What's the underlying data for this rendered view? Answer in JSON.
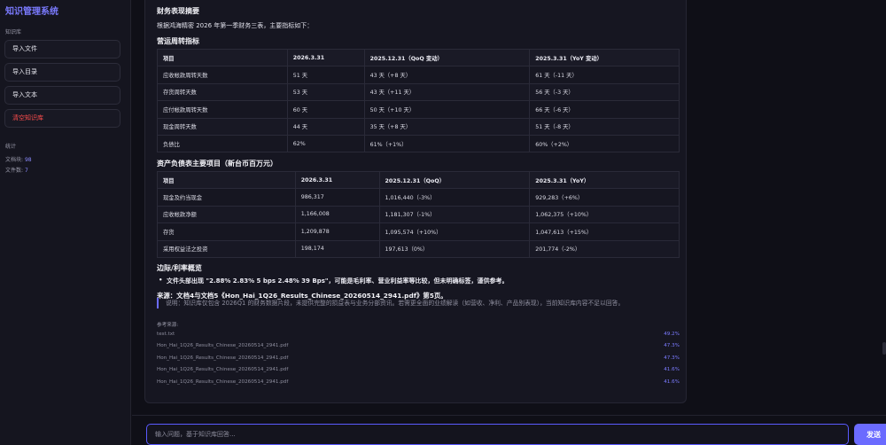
{
  "sidebar": {
    "title": "知识管理系统",
    "kb_label": "知识库",
    "buttons": {
      "import_file": "导入文件",
      "import_dir": "导入目录",
      "import_text": "导入文本",
      "clear_kb": "清空知识库"
    },
    "stats_label": "统计",
    "stats": {
      "chunks_label": "文档块: ",
      "chunks_value": "98",
      "files_label": "文件数: ",
      "files_value": "7"
    }
  },
  "answer": {
    "title": "财务表现摘要",
    "intro": "根据鸿海精密 2026 年第一季财务三表，主要指标如下：",
    "turnover": {
      "heading": "营运周转指标",
      "headers": [
        "项目",
        "2026.3.31",
        "2025.12.31（QoQ 变动）",
        "2025.3.31（YoY 变动）"
      ],
      "rows": [
        [
          "应收帐款周转天数",
          "51 天",
          "43 天（+8 天）",
          "61 天（-11 天）"
        ],
        [
          "存货周转天数",
          "53 天",
          "43 天（+11 天）",
          "56 天（-3 天）"
        ],
        [
          "应付帐款周转天数",
          "60 天",
          "50 天（+10 天）",
          "66 天（-6 天）"
        ],
        [
          "现金周转天数",
          "44 天",
          "35 天（+8 天）",
          "51 天（-8 天）"
        ],
        [
          "负债比",
          "62%",
          "61%（+1%）",
          "60%（+2%）"
        ]
      ]
    },
    "balance": {
      "heading": "资产负债表主要项目（新台币百万元）",
      "headers": [
        "项目",
        "2026.3.31",
        "2025.12.31（QoQ）",
        "2025.3.31（YoY）"
      ],
      "rows": [
        [
          "现金及约当现金",
          "986,317",
          "1,016,440（-3%）",
          "929,283（+6%）"
        ],
        [
          "应收帐款净额",
          "1,166,008",
          "1,181,307（-1%）",
          "1,062,375（+10%）"
        ],
        [
          "存货",
          "1,209,878",
          "1,095,574（+10%）",
          "1,047,613（+15%）"
        ],
        [
          "采用权益法之投资",
          "198,174",
          "197,613（0%）",
          "201,774（-2%）"
        ]
      ]
    },
    "margin_heading": "边际/利率概览",
    "margin_bullet": "文件头部出现 \"2.88% 2.83% 5 bps 2.48% 39 Bps\"，可能是毛利率、营业利益率等比较，但未明确标签，谨供参考。",
    "source": "来源：文档4与文档5《Hon_Hai_1Q26_Results_Chinese_20260514_2941.pdf》第5页。",
    "note": "说明：知识库仅包含 2026Q1 的财务数据片段，未提供完整的损益表与业务分部资讯。若需更全面的业绩解读（如营收、净利、产品别表现），当前知识库内容不足以回答。",
    "refs_label": "参考来源:",
    "refs": [
      {
        "name": "test.txt",
        "score": "49.2%"
      },
      {
        "name": "Hon_Hai_1Q26_Results_Chinese_20260514_2941.pdf",
        "score": "47.3%"
      },
      {
        "name": "Hon_Hai_1Q26_Results_Chinese_20260514_2941.pdf",
        "score": "47.3%"
      },
      {
        "name": "Hon_Hai_1Q26_Results_Chinese_20260514_2941.pdf",
        "score": "41.6%"
      },
      {
        "name": "Hon_Hai_1Q26_Results_Chinese_20260514_2941.pdf",
        "score": "41.6%"
      }
    ]
  },
  "input": {
    "placeholder": "输入问题，基于知识库回答...",
    "send_label": "发送"
  },
  "colors": {
    "accent": "#6b6bff",
    "danger": "#ff4d4d",
    "background": "#0f0f17"
  }
}
